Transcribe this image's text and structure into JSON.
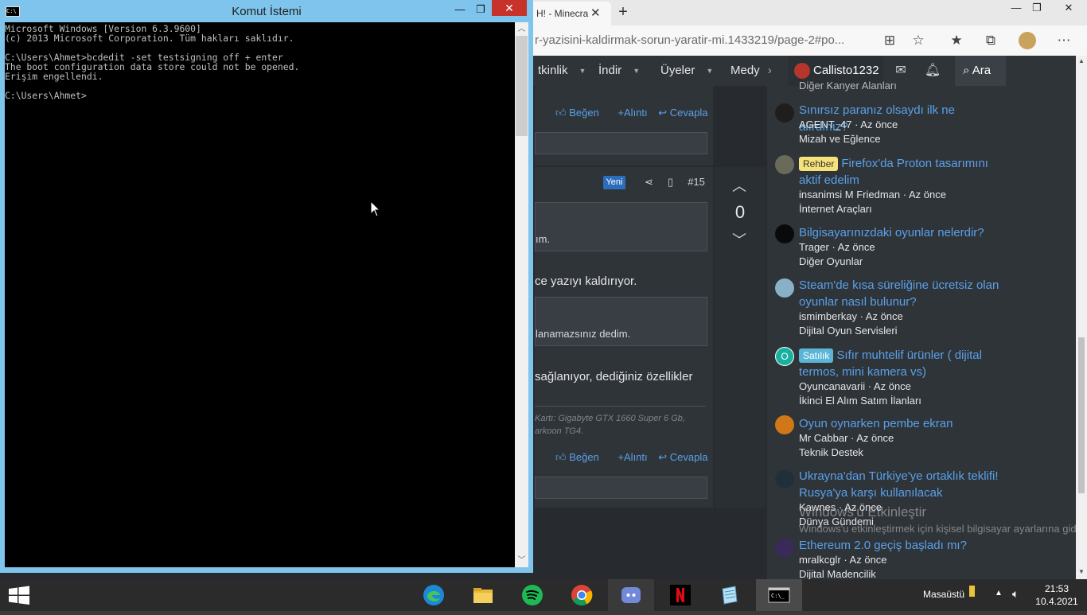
{
  "browser": {
    "tab_title": "H! - Minecra",
    "url": "r-yazisini-kaldirmak-sorun-yaratir-mi.1433219/page-2#po...",
    "nav": {
      "items": [
        "tkinlik",
        "İndir",
        "Üyeler",
        "Medy"
      ],
      "user": "Callisto1232",
      "search": "Ara"
    },
    "posts": {
      "react_like": "Beğen",
      "react_quote": "+Alıntı",
      "react_reply": "Cevapla",
      "badge_new": "Yeni",
      "post_number": "#15",
      "quote1_tail": "ım.",
      "text1": "ce yazıyı kaldırıyor.",
      "quote2_tail": "lanamazsınız dedim.",
      "text2": "sağlanıyor, dediğiniz özellikler",
      "sig_line1": "Kartı: Gigabyte GTX 1660 Super 6 Gb,",
      "sig_line2": "arkoon TG4.",
      "vote_count": "0"
    },
    "sidebar": {
      "top_cut": "Diğer Kanyer Alanları",
      "items": [
        {
          "badge": "",
          "title": "Sınırsız paranız olsaydı ilk ne alırdınız?",
          "meta": "AGENT_47 · Az önce",
          "forum": "Mizah ve Eğlence",
          "avatar_color": "#1e1e1e"
        },
        {
          "badge": "Rehber",
          "title": "Firefox'da Proton tasarımını aktif edelim",
          "meta": "insanimsi M Friedman · Az önce",
          "forum": "İnternet Araçları",
          "avatar_color": "#6a6a5a"
        },
        {
          "badge": "",
          "title": "Bilgisayarınızdaki oyunlar nelerdir?",
          "meta": "Trager · Az önce",
          "forum": "Diğer Oyunlar",
          "avatar_color": "#0a0a0a"
        },
        {
          "badge": "",
          "title": "Steam'de kısa süreliğine ücretsiz olan oyunlar nasıl bulunur?",
          "meta": "ismimberkay · Az önce",
          "forum": "Dijital Oyun Servisleri",
          "avatar_color": "#8ab0c8"
        },
        {
          "badge": "Satılık",
          "title": "Sıfır muhtelif ürünler ( dijital termos, mini kamera vs)",
          "meta": "Oyuncanavarii · Az önce",
          "forum": "İkinci El Alım Satım İlanları",
          "avatar_color": "#1ab0a0",
          "avatar_letter": "O"
        },
        {
          "badge": "",
          "title": "Oyun oynarken pembe ekran",
          "meta": "Mr Cabbar · Az önce",
          "forum": "Teknik Destek",
          "avatar_color": "#d07818"
        },
        {
          "badge": "",
          "title": "Ukrayna'dan Türkiye'ye ortaklık teklifi! Rusya'ya karşı kullanılacak",
          "meta": "Kawnes · Az önce",
          "forum": "Dünya Gündemi",
          "avatar_color": "#20303a"
        },
        {
          "badge": "",
          "title": "Ethereum 2.0 geçiş başladı mı?",
          "meta": "mralkcglr · Az önce",
          "forum": "Dijital Madencilik",
          "avatar_color": "#3a2a5a"
        }
      ],
      "watermark_title": "Windows'u Etkinleştir",
      "watermark_text": "Windows'u etkinleştirmek için kişisel bilgisayar ayarlarına gidin."
    }
  },
  "cmd": {
    "title": "Komut İstemi",
    "lines": "Microsoft Windows [Version 6.3.9600]\n(c) 2013 Microsoft Corporation. Tüm hakları saklıdır.\n\nC:\\Users\\Ahmet>bcdedit -set testsigning off + enter\nThe boot configuration data store could not be opened.\nErişim engellendi.\n\nC:\\Users\\Ahmet>"
  },
  "taskbar": {
    "apps": [
      "edge",
      "file-explorer",
      "spotify",
      "chrome",
      "discord",
      "netflix",
      "notepad",
      "cmd"
    ],
    "desktop_label": "Masaüstü",
    "time": "21:53",
    "date": "10.4.2021"
  },
  "colors": {
    "cmd_frame": "#7fc4ec",
    "site_bg": "#2f3439",
    "link": "#5aa0e8",
    "badge_rehber": "#f6e27a",
    "badge_satilik": "#5bb5d6"
  }
}
